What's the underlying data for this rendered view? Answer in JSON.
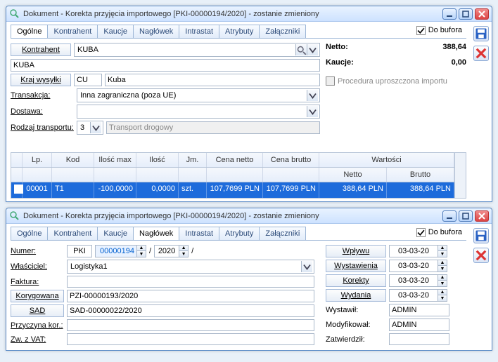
{
  "win1": {
    "title": "Dokument - Korekta przyjęcia importowego [PKI-00000194/2020]  - zostanie zmieniony",
    "tabs": [
      "Ogólne",
      "Kontrahent",
      "Kaucje",
      "Nagłówek",
      "Intrastat",
      "Atrybuty",
      "Załączniki"
    ],
    "bufora_label": "Do bufora",
    "kontrahent_btn": "Kontrahent",
    "kontrahent_code": "KUBA",
    "kontrahent_name": "KUBA",
    "kraj_btn": "Kraj wysyłki",
    "kraj_code": "CU",
    "kraj_name": "Kuba",
    "transakcja_lbl": "Transakcja:",
    "transakcja_val": "Inna zagraniczna (poza UE)",
    "dostawa_lbl": "Dostawa:",
    "dostawa_val": "",
    "rodzaj_lbl": "Rodzaj transportu:",
    "rodzaj_val": "3",
    "rodzaj_desc": "Transport drogowy",
    "netto_lbl": "Netto:",
    "netto_val": "388,64",
    "kaucje_lbl": "Kaucje:",
    "kaucje_val": "0,00",
    "procedura_lbl": "Procedura uproszczona importu",
    "grid": {
      "headers": {
        "lp": "Lp.",
        "kod": "Kod",
        "iloscmax": "Ilość max",
        "ilosc": "Ilość",
        "jm": "Jm.",
        "cenanetto": "Cena netto",
        "cenabrutto": "Cena brutto",
        "wartosci": "Wartości",
        "netto": "Netto",
        "brutto": "Brutto"
      },
      "row": {
        "lp": "00001",
        "kod": "T1",
        "iloscmax": "-100,0000",
        "ilosc": "0,0000",
        "jm": "szt.",
        "cenanetto": "107,7699 PLN",
        "cenabrutto": "107,7699 PLN",
        "netto": "388,64 PLN",
        "brutto": "388,64 PLN"
      }
    }
  },
  "win2": {
    "title": "Dokument - Korekta przyjęcia importowego [PKI-00000194/2020]  - zostanie zmieniony",
    "tabs": [
      "Ogólne",
      "Kontrahent",
      "Kaucje",
      "Nagłówek",
      "Intrastat",
      "Atrybuty",
      "Załączniki"
    ],
    "bufora_label": "Do bufora",
    "numer_lbl": "Numer:",
    "numer_pre": "PKI",
    "numer_num": "00000194",
    "numer_year": "2020",
    "wlasciciel_lbl": "Właściciel:",
    "wlasciciel_val": "Logistyka1",
    "faktura_lbl": "Faktura:",
    "faktura_val": "",
    "korygowana_btn": "Korygowana",
    "korygowana_val": "PZI-00000193/2020",
    "sad_btn": "SAD",
    "sad_val": "SAD-00000022/2020",
    "przyczyna_lbl": "Przyczyna kor.:",
    "przyczyna_val": "",
    "zwvat_lbl": "Zw. z VAT:",
    "zwvat_val": "",
    "dates": {
      "wplywu": {
        "lbl": "Wpływu",
        "val": "03-03-20"
      },
      "wystawienia": {
        "lbl": "Wystawienia",
        "val": "03-03-20"
      },
      "korekty": {
        "lbl": "Korekty",
        "val": "03-03-20"
      },
      "wydania": {
        "lbl": "Wydania",
        "val": "03-03-20"
      }
    },
    "who": {
      "wystawil_lbl": "Wystawił:",
      "wystawil": "ADMIN",
      "modyfikowal_lbl": "Modyfikował:",
      "modyfikowal": "ADMIN",
      "zatwierdzil_lbl": "Zatwierdził:",
      "zatwierdzil": ""
    }
  }
}
